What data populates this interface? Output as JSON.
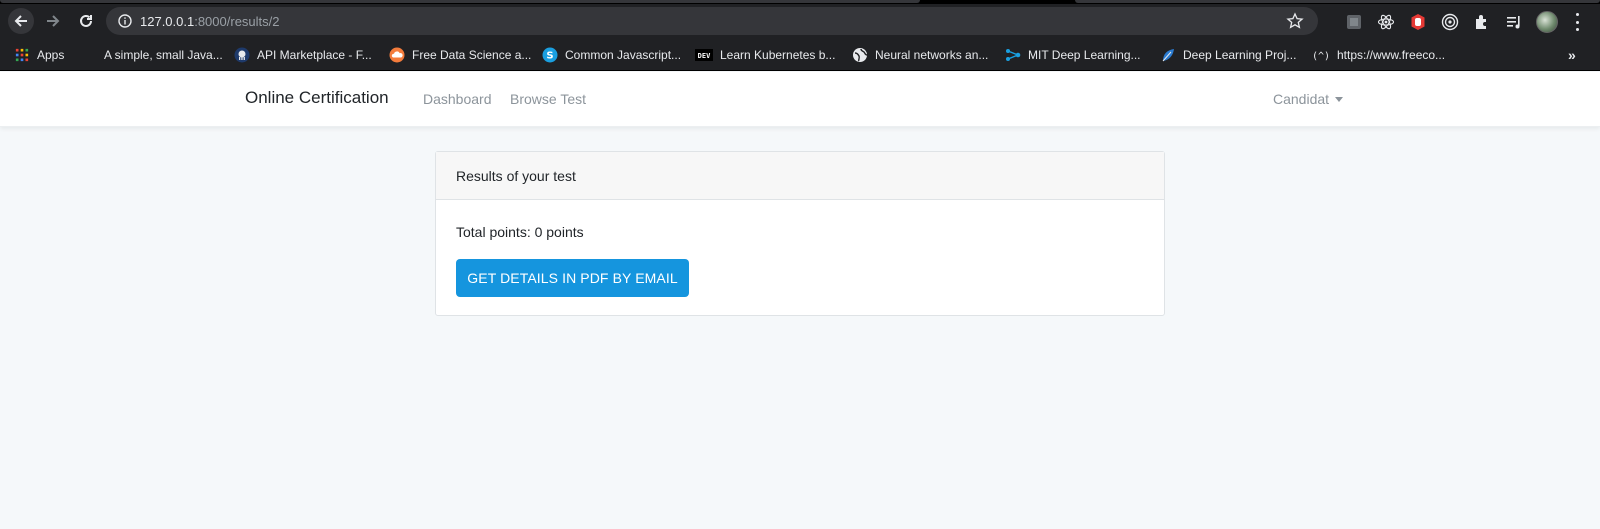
{
  "browser": {
    "url_host": "127.0.0.1",
    "url_rest": ":8000/results/2",
    "bookmarks": [
      {
        "label": "Apps",
        "icon": "apps-grid-icon"
      },
      {
        "label": "A simple, small Java...",
        "icon": "none"
      },
      {
        "label": "API Marketplace - F...",
        "icon": "octopus-icon"
      },
      {
        "label": "Free Data Science a...",
        "icon": "cloud-icon"
      },
      {
        "label": "Common Javascript...",
        "icon": "s-logo-icon"
      },
      {
        "label": "Learn Kubernetes b...",
        "icon": "dev-logo-icon"
      },
      {
        "label": "Neural networks an...",
        "icon": "globe-icon"
      },
      {
        "label": "MIT Deep Learning...",
        "icon": "network-icon"
      },
      {
        "label": "Deep Learning Proj...",
        "icon": "leaf-icon"
      },
      {
        "label": "https://www.freeco...",
        "icon": "freecodecamp-icon"
      }
    ],
    "more": "»"
  },
  "navbar": {
    "brand": "Online Certification",
    "links": [
      "Dashboard",
      "Browse Test"
    ],
    "user": "Candidat"
  },
  "card": {
    "header": "Results of your test",
    "points_text": "Total points: 0 points",
    "button_label": "GET DETAILS IN PDF BY EMAIL"
  },
  "colors": {
    "primary_button": "#1595de",
    "page_background": "#f5f8fa",
    "browser_chrome": "#202124"
  }
}
